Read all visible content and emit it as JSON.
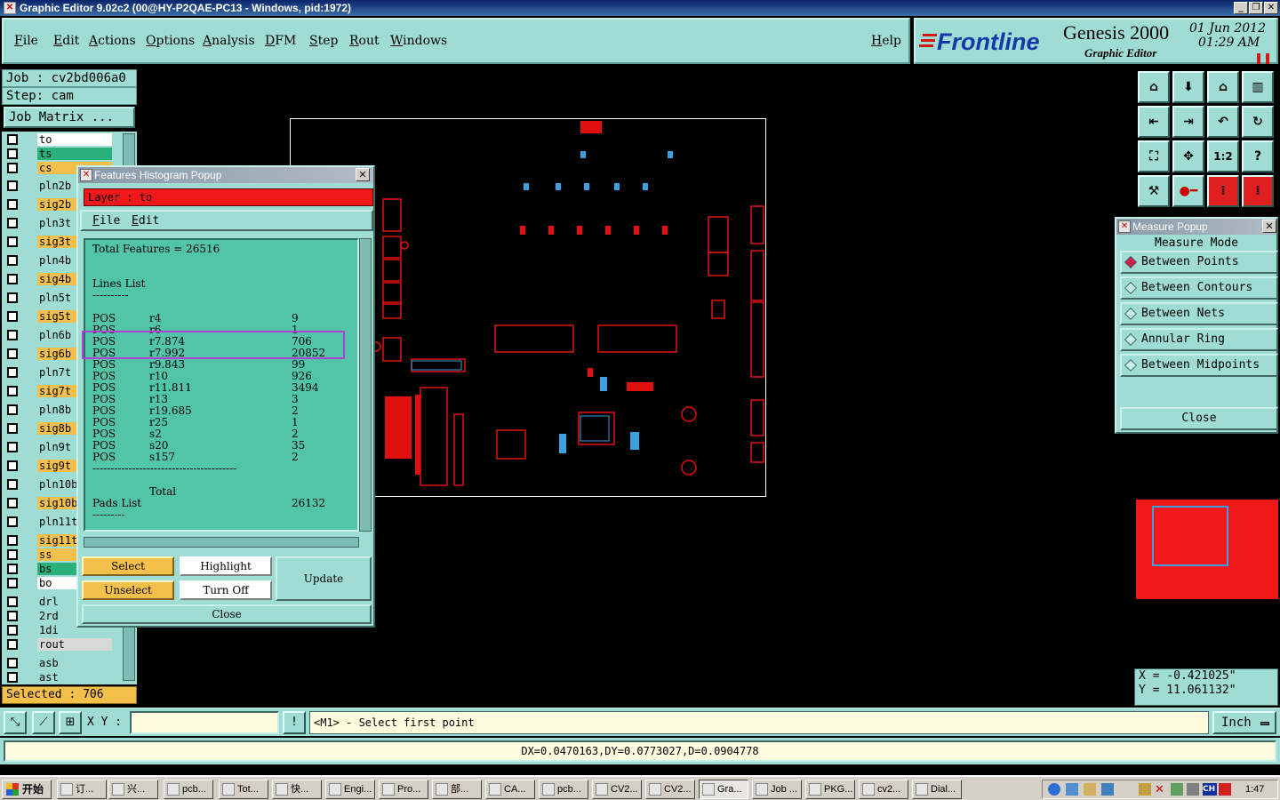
{
  "window": {
    "title": "Graphic Editor 9.02c2 (00@HY-P2QAE-PC13 - Windows, pid:1972)"
  },
  "menu": [
    "File",
    "Edit",
    "Actions",
    "Options",
    "Analysis",
    "DFM",
    "Step",
    "Rout",
    "Windows"
  ],
  "help_label": "Help",
  "brand": {
    "logo": "Frontline",
    "product": "Genesis 2000",
    "subtitle": "Graphic Editor",
    "date": "01 Jun 2012",
    "time": "01:29  AM"
  },
  "job": {
    "job_line": "Job : cv2bd006a0",
    "step_line": "Step: cam",
    "matrix_button": "Job Matrix ..."
  },
  "layers": [
    {
      "name": "to",
      "color": "#ffffff",
      "checked": false
    },
    {
      "name": "ts",
      "color": "#2ab07a",
      "checked": false
    },
    {
      "name": "cs",
      "color": "#f4c04c",
      "checked": false
    },
    {
      "name": "pln2b",
      "color": "#9fdcd4",
      "checked": false
    },
    {
      "name": "sig2b",
      "color": "#f4c04c",
      "checked": false
    },
    {
      "name": "pln3t",
      "color": "#9fdcd4",
      "checked": false
    },
    {
      "name": "sig3t",
      "color": "#f4c04c",
      "checked": false
    },
    {
      "name": "pln4b",
      "color": "#9fdcd4",
      "checked": false
    },
    {
      "name": "sig4b",
      "color": "#f4c04c",
      "checked": false
    },
    {
      "name": "pln5t",
      "color": "#9fdcd4",
      "checked": false
    },
    {
      "name": "sig5t",
      "color": "#f4c04c",
      "checked": false
    },
    {
      "name": "pln6b",
      "color": "#9fdcd4",
      "checked": false
    },
    {
      "name": "sig6b",
      "color": "#f4c04c",
      "checked": false
    },
    {
      "name": "pln7t",
      "color": "#9fdcd4",
      "checked": false
    },
    {
      "name": "sig7t",
      "color": "#f4c04c",
      "checked": false
    },
    {
      "name": "pln8b",
      "color": "#9fdcd4",
      "checked": false
    },
    {
      "name": "sig8b",
      "color": "#f4c04c",
      "checked": false
    },
    {
      "name": "pln9t",
      "color": "#9fdcd4",
      "checked": false
    },
    {
      "name": "sig9t",
      "color": "#f4c04c",
      "checked": false
    },
    {
      "name": "pln10b",
      "color": "#9fdcd4",
      "checked": false
    },
    {
      "name": "sig10b",
      "color": "#f4c04c",
      "checked": false
    },
    {
      "name": "pln11t",
      "color": "#9fdcd4",
      "checked": false
    },
    {
      "name": "sig11t",
      "color": "#f4c04c",
      "checked": false
    },
    {
      "name": "ss",
      "color": "#f4c04c",
      "checked": false
    },
    {
      "name": "bs",
      "color": "#2ab07a",
      "checked": false
    },
    {
      "name": "bo",
      "color": "#ffffff",
      "checked": false
    },
    {
      "name": "drl",
      "color": "#9fdcd4",
      "checked": false
    },
    {
      "name": "2rd",
      "color": "#9fdcd4",
      "checked": false
    },
    {
      "name": "1di",
      "color": "#9fdcd4",
      "checked": false
    },
    {
      "name": "rout",
      "color": "#d8d8d8",
      "checked": false
    },
    {
      "name": "asb",
      "color": "#9fdcd4",
      "checked": false
    },
    {
      "name": "ast",
      "color": "#9fdcd4",
      "checked": false
    }
  ],
  "selected": "Selected : 706",
  "histogram": {
    "title": "Features Histogram Popup",
    "layer": "Layer :  to",
    "menu": [
      "File",
      "Edit"
    ],
    "total": "Total Features = 26516",
    "lines_heading": "Lines List",
    "underline": "----------",
    "rows": [
      {
        "pol": "POS",
        "sym": "r4",
        "count": "9"
      },
      {
        "pol": "POS",
        "sym": "r6",
        "count": "1"
      },
      {
        "pol": "POS",
        "sym": "r7.874",
        "count": "706"
      },
      {
        "pol": "POS",
        "sym": "r7.992",
        "count": "20852"
      },
      {
        "pol": "POS",
        "sym": "r9.843",
        "count": "99"
      },
      {
        "pol": "POS",
        "sym": "r10",
        "count": "926"
      },
      {
        "pol": "POS",
        "sym": "r11.811",
        "count": "3494"
      },
      {
        "pol": "POS",
        "sym": "r13",
        "count": "3"
      },
      {
        "pol": "POS",
        "sym": "r19.685",
        "count": "2"
      },
      {
        "pol": "POS",
        "sym": "r25",
        "count": "1"
      },
      {
        "pol": "POS",
        "sym": "s2",
        "count": "2"
      },
      {
        "pol": "POS",
        "sym": "s20",
        "count": "35"
      },
      {
        "pol": "POS",
        "sym": "s157",
        "count": "2"
      }
    ],
    "separator": "----------------------------------------",
    "total_label": "Total",
    "total_value": "26132",
    "pads_heading": "Pads List",
    "pads_underline": "---------",
    "buttons": {
      "select": "Select",
      "highlight": "Highlight",
      "update": "Update",
      "unselect": "Unselect",
      "turn_off": "Turn Off",
      "close": "Close"
    }
  },
  "measure": {
    "title": "Measure Popup",
    "heading": "Measure Mode",
    "options": [
      "Between Points",
      "Between Contours",
      "Between Nets",
      "Annular Ring",
      "Between Midpoints"
    ],
    "selected_index": 0,
    "close": "Close"
  },
  "coords": {
    "x": "X = -0.421025\"",
    "y": "Y = 11.061132\""
  },
  "bottom": {
    "xy_label": "X Y :",
    "prompt": "<M1> - Select first point",
    "units": "Inch"
  },
  "status": "DX=0.0470163,DY=0.0773027,D=0.0904778",
  "taskbar": {
    "start": "开始",
    "tasks": [
      "订...",
      "兴...",
      "pcb...",
      "Tot...",
      "快...",
      "Engi...",
      "Pro...",
      "部...",
      "CA...",
      "pcb...",
      "CV2...",
      "CV2...",
      "Gra...",
      "Job ...",
      "PKG...",
      "cv2...",
      "Dial..."
    ],
    "active_index": 12,
    "clock": "1:47",
    "lang": "CH"
  },
  "colors": {
    "teal": "#9fdcd4",
    "yellow": "#f4c04c",
    "red": "#f01818",
    "board": "#e01010"
  }
}
